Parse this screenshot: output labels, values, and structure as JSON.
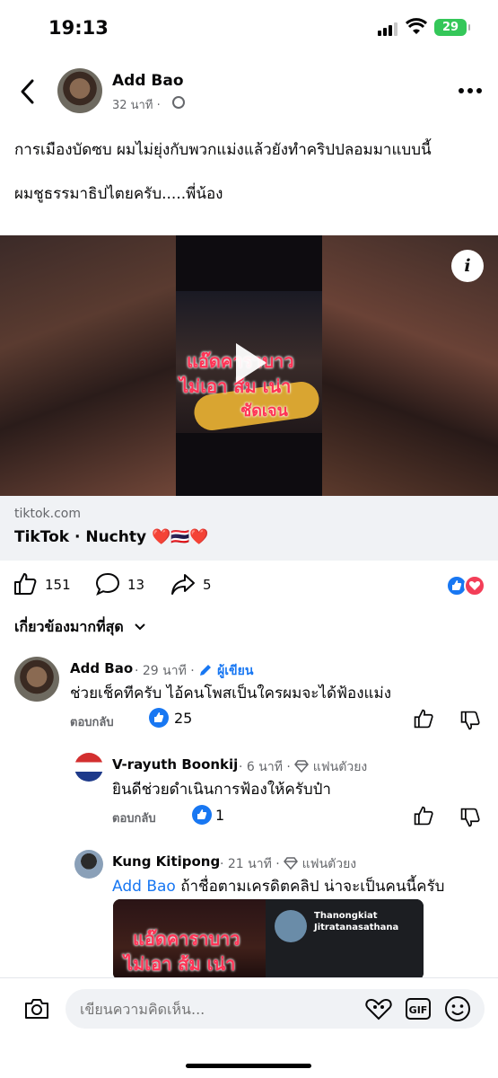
{
  "status_bar": {
    "time": "19:13",
    "battery": "29"
  },
  "post": {
    "author": "Add Bao",
    "time": "32 นาที ·",
    "text_line1": "การเมืองบัดซบ ผมไม่ยุ่งกับพวกแม่งแล้วยังทำคริปปลอมมาแบบนี้",
    "text_line2": "ผมชูธรรมาธิปไตยครับ.....พี่น้อง",
    "video_overlay": [
      "แอ๊ดคาราบาว",
      "ไม่เอา ส้ม เน่า",
      "ชัดเจน"
    ],
    "link": {
      "domain": "tiktok.com",
      "title": "TikTok · Nuchty",
      "emoji": "❤️🇹🇭❤️"
    },
    "likes": "151",
    "comments": "13",
    "shares": "5"
  },
  "sort_label": "เกี่ยวข้องมากที่สุด",
  "comments": [
    {
      "name": "Add Bao",
      "meta": "· 29 นาที ·",
      "badge": "ผู้เขียน",
      "text": "ช่วยเช็คทีครับ ไอ้คนโพสเป็นใครผมจะได้ฟ้องแม่ง",
      "reply": "ตอบกลับ",
      "likes": "25"
    },
    {
      "name": "V-rayuth Boonkij",
      "meta": "· 6 นาที ·",
      "badge": "แฟนตัวยง",
      "text": "ยินดีช่วยดำเนินการฟ้องให้ครับป๋า",
      "reply": "ตอบกลับ",
      "likes": "1"
    },
    {
      "name": "Kung Kitipong",
      "meta": "· 21 นาที ·",
      "badge": "แฟนตัวยง",
      "mention": "Add Bao",
      "text": " ถ้าชื่อตามเครดิตคลิป น่าจะเป็นคนนี้ครับ",
      "embed_left_line1": "แอ๊ดคาราบาว",
      "embed_left_line2": "ไม่เอา ส้ม เน่า",
      "embed_right_name": "Thanongkiat Jitratanasathana"
    }
  ],
  "composer": {
    "placeholder": "เขียนความคิดเห็น..."
  },
  "colors": {
    "facebook_blue": "#1877f2",
    "like_blue": "#1877f2",
    "love_red": "#f33e58"
  }
}
